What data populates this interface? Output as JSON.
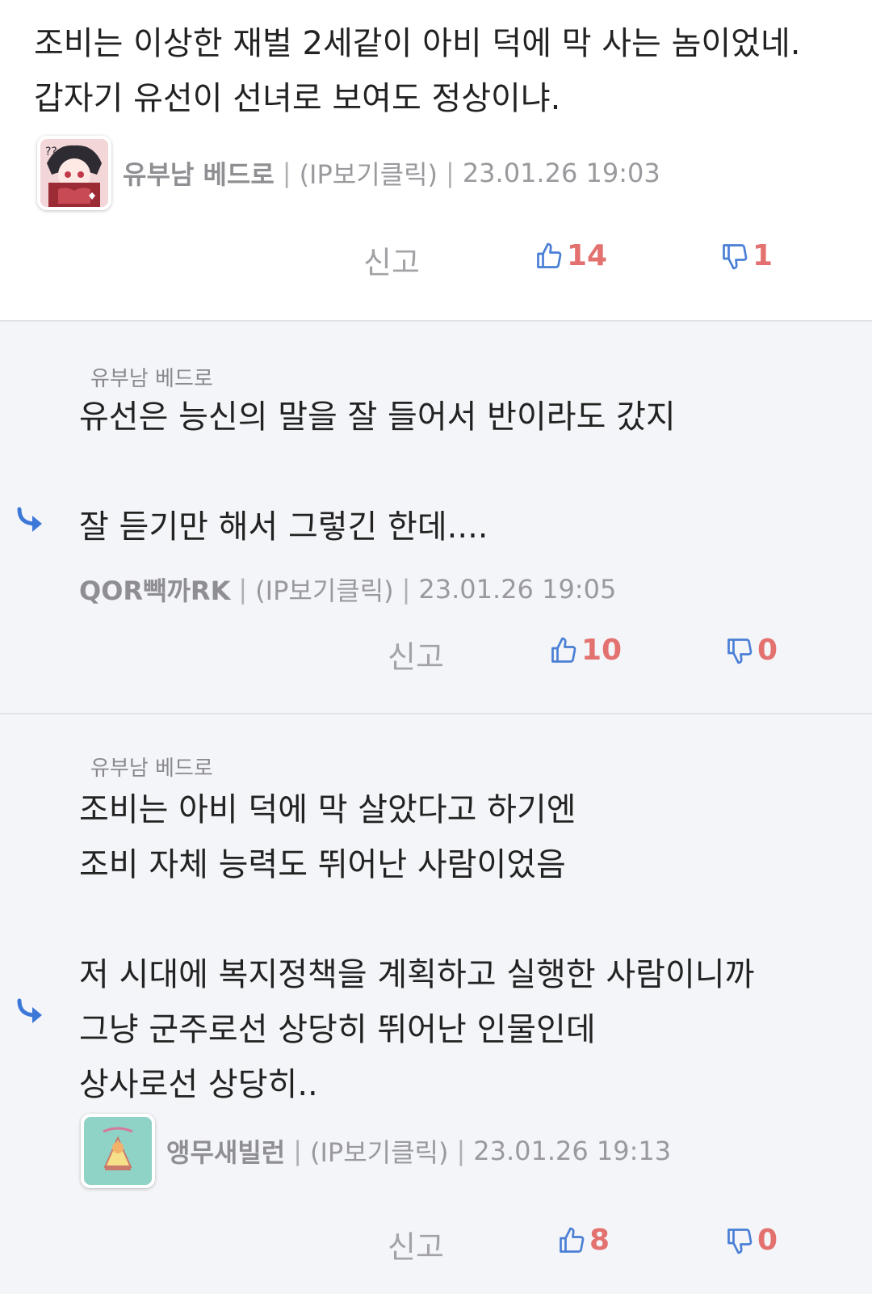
{
  "comments": [
    {
      "body": "조비는 이상한 재벌 2세같이 아비 덕에 막 사는 놈이었네.\n갑자기 유선이 선녀로 보여도 정상이냐.",
      "nick": "유부남 베드로",
      "ip": "(IP보기클릭)",
      "time": "23.01.26 19:03",
      "report": "신고",
      "up": "14",
      "down": "1"
    },
    {
      "parent": "유부남 베드로",
      "body": "유선은 능신의 말을 잘 들어서 반이라도 갔지\n\n잘 듣기만 해서 그렇긴 한데....",
      "nick": "QOR빽까RK",
      "ip": "(IP보기클릭)",
      "time": "23.01.26 19:05",
      "report": "신고",
      "up": "10",
      "down": "0"
    },
    {
      "parent": "유부남 베드로",
      "body": "조비는 아비 덕에 막 살았다고 하기엔\n조비 자체 능력도 뛰어난 사람이었음\n\n저 시대에 복지정책을 계획하고 실행한 사람이니까\n그냥 군주로선 상당히 뛰어난 인물인데\n상사로선 상당히..",
      "nick": "앵무새빌런",
      "ip": "(IP보기클릭)",
      "time": "23.01.26 19:13",
      "report": "신고",
      "up": "8",
      "down": "0"
    }
  ],
  "separator": "|",
  "colors": {
    "thumb": "#4a7fd6",
    "count": "#e3716f",
    "reply_arrow": "#3d78d8"
  },
  "icons": {
    "up": "thumbs-up-icon",
    "down": "thumbs-down-icon",
    "reply": "reply-arrow-icon"
  }
}
